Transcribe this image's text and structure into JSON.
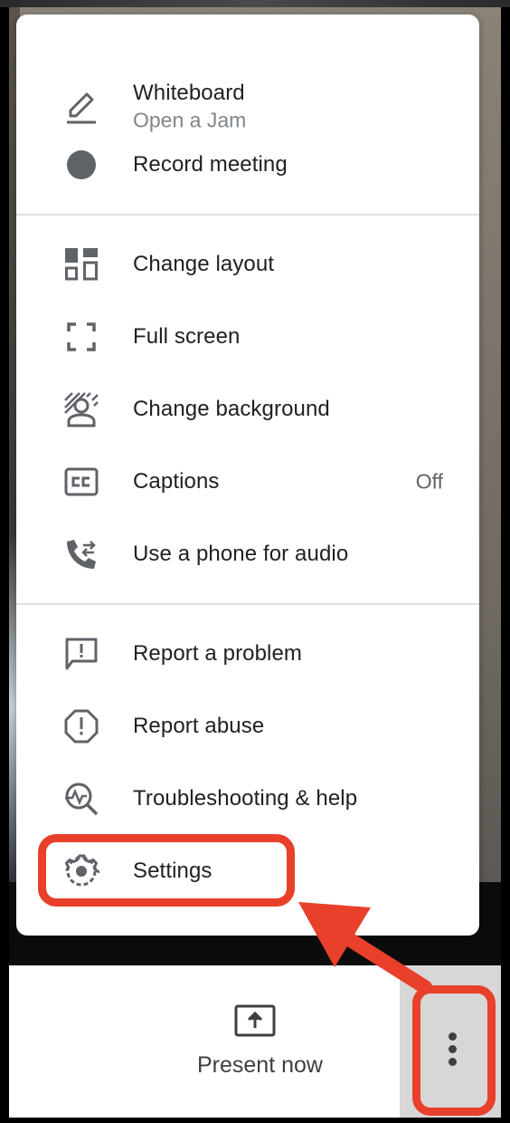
{
  "menu": {
    "whiteboard": {
      "label": "Whiteboard",
      "sublabel": "Open a Jam"
    },
    "record": {
      "label": "Record meeting"
    },
    "change_layout": {
      "label": "Change layout"
    },
    "full_screen": {
      "label": "Full screen"
    },
    "change_background": {
      "label": "Change background"
    },
    "captions": {
      "label": "Captions",
      "status": "Off"
    },
    "phone_audio": {
      "label": "Use a phone for audio"
    },
    "report_problem": {
      "label": "Report a problem"
    },
    "report_abuse": {
      "label": "Report abuse"
    },
    "troubleshooting": {
      "label": "Troubleshooting & help"
    },
    "settings": {
      "label": "Settings"
    }
  },
  "bottom_bar": {
    "present_label": "Present now"
  },
  "colors": {
    "highlight": "#e8402a",
    "icon": "#5f6368",
    "text": "#202124"
  }
}
